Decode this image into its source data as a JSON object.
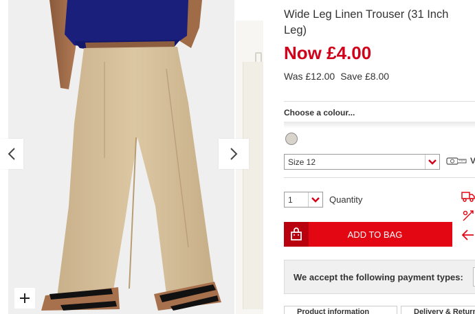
{
  "product": {
    "title": "Wide Leg Linen Trouser (31 Inch Leg)",
    "price_now": "Now £4.00",
    "price_was": "Was £12.00",
    "price_save": "Save £8.00"
  },
  "colour": {
    "label": "Choose a colour...",
    "swatch_color": "#d8d4cc"
  },
  "size": {
    "selected": "Size 12",
    "guide_text": "V"
  },
  "quantity": {
    "selected": "1",
    "label": "Quantity"
  },
  "add_to_bag": {
    "label": "ADD TO BAG"
  },
  "payment": {
    "label": "We accept the following payment types:"
  },
  "tabs": [
    {
      "label": "Product information"
    },
    {
      "label": "Delivery & Returns"
    }
  ],
  "gallery": {
    "prev_icon": "chevron-left-icon",
    "next_icon": "chevron-right-icon",
    "zoom_icon": "plus-icon"
  },
  "colors": {
    "accent_red": "#e30613",
    "price_red": "#d0021b",
    "top_blue": "#1a1f7c",
    "trouser_beige": "#d9c3a0"
  }
}
